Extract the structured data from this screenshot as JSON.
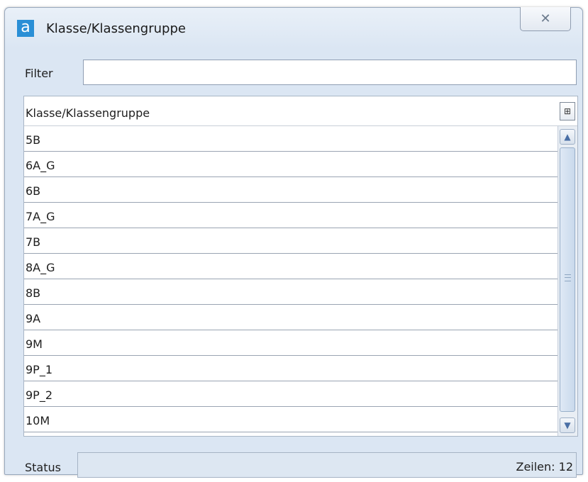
{
  "window": {
    "title": "Klasse/Klassengruppe",
    "app_icon_letter": "a",
    "close_glyph": "✕"
  },
  "filter": {
    "label": "Filter",
    "value": "",
    "placeholder": ""
  },
  "grid": {
    "column_header": "Klasse/Klassengruppe",
    "column_chooser_icon": "⊞",
    "rows": [
      "5B",
      "6A_G",
      "6B",
      "7A_G",
      "7B",
      "8A_G",
      "8B",
      "9A",
      "9M",
      "9P_1",
      "9P_2",
      "10M"
    ]
  },
  "scrollbar": {
    "up_glyph": "▲",
    "down_glyph": "▼"
  },
  "status": {
    "label": "Status",
    "row_count": "Zeilen: 12"
  },
  "colors": {
    "window_bg": "#dbe6f3",
    "app_icon": "#2a8fd6",
    "grid_bg": "#ffffff"
  }
}
